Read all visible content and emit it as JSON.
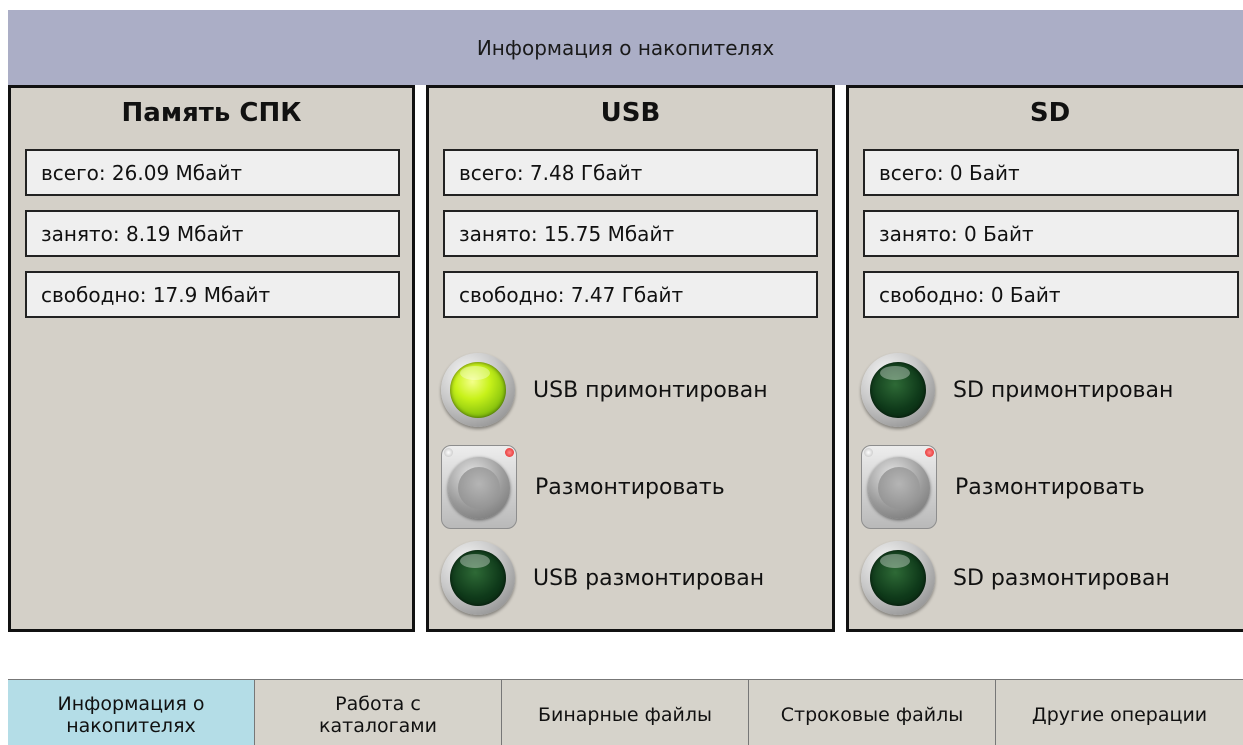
{
  "header": {
    "title": "Информация о накопителях"
  },
  "panels": [
    {
      "title": "Память СПК",
      "fields": [
        "всего: 26.09 Мбайт",
        "занято: 8.19 Мбайт",
        "свободно: 17.9 Мбайт"
      ]
    },
    {
      "title": "USB",
      "fields": [
        "всего: 7.48 Гбайт",
        "занято: 15.75 Мбайт",
        "свободно: 7.47 Гбайт"
      ],
      "mounted_label": "USB примонтирован",
      "unmount_label": "Размонтировать",
      "unmounted_label": "USB размонтирован",
      "mounted_lamp_on": true,
      "unmounted_lamp_on": false
    },
    {
      "title": "SD",
      "fields": [
        "всего: 0 Байт",
        "занято: 0 Байт",
        "свободно: 0 Байт"
      ],
      "mounted_label": "SD примонтирован",
      "unmount_label": "Размонтировать",
      "unmounted_label": "SD размонтирован",
      "mounted_lamp_on": false,
      "unmounted_lamp_on": false
    }
  ],
  "tabs": [
    {
      "label": "Информация о\nнакопителях",
      "active": true
    },
    {
      "label": "Работа с\nкаталогами",
      "active": false
    },
    {
      "label": "Бинарные файлы",
      "active": false
    },
    {
      "label": "Строковые файлы",
      "active": false
    },
    {
      "label": "Другие операции",
      "active": false
    }
  ],
  "colors": {
    "header_bg": "#abaec6",
    "panel_bg": "#d4d0c8",
    "active_tab": "#b4dde7",
    "lamp_on": "#c8f21a",
    "lamp_off": "#0f3a1a"
  }
}
